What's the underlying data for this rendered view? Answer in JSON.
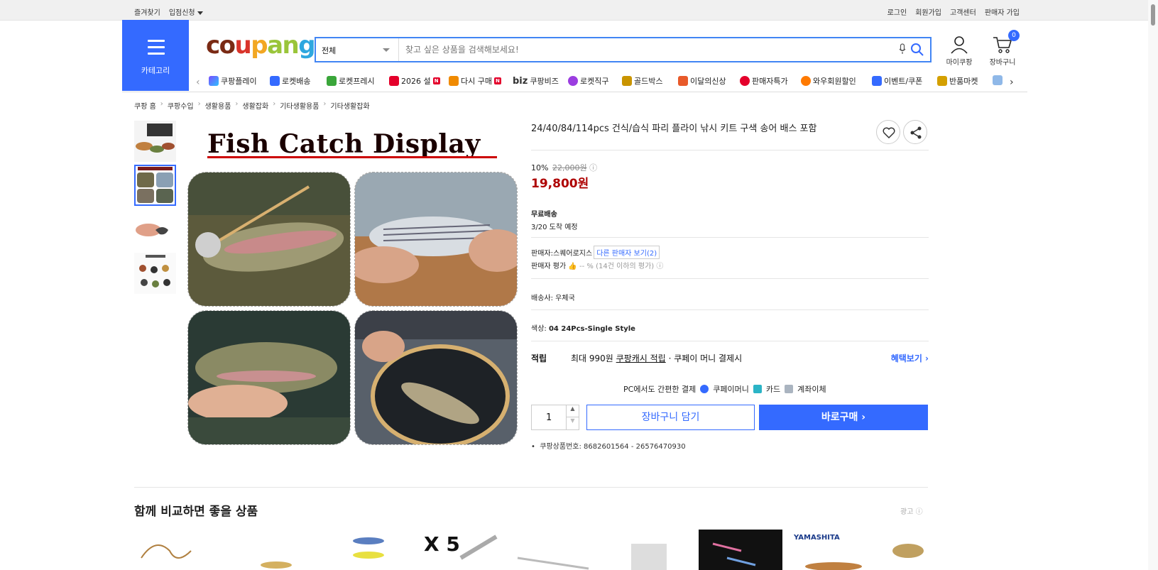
{
  "topbar": {
    "left": [
      "즐겨찾기",
      "입점신청"
    ],
    "right": [
      "로그인",
      "회원가입",
      "고객센터",
      "판매자 가입"
    ]
  },
  "header": {
    "category_label": "카테고리",
    "logo": "coupang",
    "search": {
      "category": "전체",
      "placeholder": "찾고 싶은 상품을 검색해보세요!"
    },
    "my_coupang": "마이쿠팡",
    "cart": {
      "label": "장바구니",
      "count": "0"
    }
  },
  "nav": [
    {
      "label": "쿠팡플레이",
      "color": "#7a4cff"
    },
    {
      "label": "로켓배송",
      "color": "#346aff"
    },
    {
      "label": "로켓프레시",
      "color": "#3aa63a"
    },
    {
      "label": "2026 설",
      "color": "#e4002b",
      "badge": "N"
    },
    {
      "label": "다시 구매",
      "color": "#f08a00",
      "badge": "N"
    },
    {
      "label": "쿠팡비즈",
      "prefix": "biz"
    },
    {
      "label": "로켓직구",
      "color": "#9b3de0"
    },
    {
      "label": "골드박스",
      "color": "#c99400"
    },
    {
      "label": "이달의신상",
      "color": "#e85a2a"
    },
    {
      "label": "판매자특가",
      "color": "#e4002b"
    },
    {
      "label": "와우회원할인",
      "color": "#ff7a00"
    },
    {
      "label": "이벤트/쿠폰",
      "color": "#346aff"
    },
    {
      "label": "반품마켓",
      "color": "#d4a000"
    }
  ],
  "breadcrumb": [
    "쿠팡 홈",
    "쿠팡수입",
    "생활용품",
    "생활잡화",
    "기타생활용품",
    "기타생활잡화"
  ],
  "gallery": {
    "banner_title": "Fish Catch Display"
  },
  "product": {
    "title": "24/40/84/114pcs 건식/습식 파리 플라이 낚시 키트 구색 송어 배스 포함",
    "discount_rate": "10%",
    "original_price": "22,000원",
    "sale_price": "19,800원",
    "shipping_title": "무료배송",
    "arrival": "3/20 도착 예정",
    "seller_label": "판매자:",
    "seller_name": "스퀘어로지스",
    "other_sellers": "다른 판매자 보기(2)",
    "seller_rating_label": "판매자 평가",
    "seller_rating_value": "-- % (14건 이하의 평가)",
    "carrier_label": "배송사:",
    "carrier": "우체국",
    "color_label": "색상:",
    "color_value": "04 24Pcs-Single Style",
    "benefit_label": "적립",
    "benefit_max": "최대 990원",
    "benefit_cash": "쿠팡캐시 적립",
    "benefit_tail": "· 쿠페이 머니 결제시",
    "benefit_link": "혜택보기",
    "pc_pay_label": "PC에서도 간편한 결제",
    "pay_methods": [
      "쿠페이머니",
      "카드",
      "계좌이체"
    ],
    "quantity": "1",
    "cart_button": "장바구니 담기",
    "buy_button": "바로구매",
    "product_number": "쿠팡상품번호: 8682601564 - 26576470930"
  },
  "compare": {
    "title": "함께 비교하면 좋을 상품",
    "ad_label": "광고",
    "rec_text": [
      "X 5",
      "YAMASHITA"
    ]
  }
}
